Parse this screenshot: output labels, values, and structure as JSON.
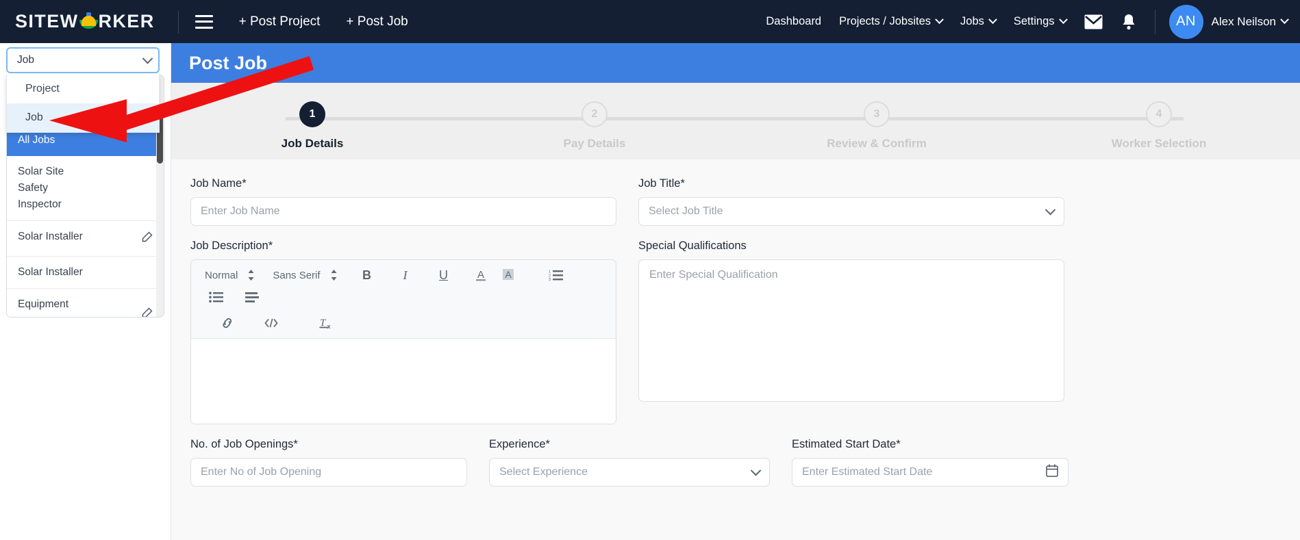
{
  "brand": {
    "name_part1": "SITEW",
    "name_part2": "RKER",
    "helmet_icon": "hardhat-icon"
  },
  "topnav": {
    "menu_icon": "hamburger-icon",
    "post_project": "+ Post Project",
    "post_job": "+ Post Job",
    "links": [
      {
        "label": "Dashboard",
        "caret": false
      },
      {
        "label": "Projects / Jobsites",
        "caret": true
      },
      {
        "label": "Jobs",
        "caret": true
      },
      {
        "label": "Settings",
        "caret": true
      }
    ],
    "mail_icon": "envelope-icon",
    "bell_icon": "bell-icon",
    "avatar_initials": "AN",
    "username": "Alex Neilson"
  },
  "left_panel": {
    "type_select": {
      "value": "Job",
      "chevron": "chevron-down-icon"
    },
    "dropdown_options": [
      {
        "label": "Project",
        "selected": false
      },
      {
        "label": "Job",
        "selected": true
      }
    ],
    "job_list": [
      {
        "label": "All Jobs",
        "active": true,
        "editable": false
      },
      {
        "label": "Solar Site Safety Inspector",
        "active": false,
        "editable": false
      },
      {
        "label": "Solar Installer",
        "active": false,
        "editable": true
      },
      {
        "label": "Solar Installer",
        "active": false,
        "editable": false
      },
      {
        "label": "Equipment",
        "active": false,
        "editable": true
      }
    ],
    "edit_icon": "pencil-icon",
    "scrollbar": "vertical-scrollbar"
  },
  "page": {
    "title": "Post Job",
    "accent_blue": "#3d7fe0",
    "dark_navy": "#141f33"
  },
  "stepper": [
    {
      "num": "1",
      "caption": "Job Details",
      "state": "done"
    },
    {
      "num": "2",
      "caption": "Pay Details",
      "state": "todo"
    },
    {
      "num": "3",
      "caption": "Review & Confirm",
      "state": "todo"
    },
    {
      "num": "4",
      "caption": "Worker Selection",
      "state": "todo"
    }
  ],
  "form": {
    "job_name": {
      "label": "Job Name*",
      "placeholder": "Enter Job Name",
      "value": ""
    },
    "job_title": {
      "label": "Job Title*",
      "placeholder": "Select Job Title",
      "value": "",
      "chevron": "chevron-down-icon"
    },
    "job_description": {
      "label": "Job Description*",
      "value": ""
    },
    "special_qualifications": {
      "label": "Special Qualifications",
      "placeholder": "Enter Special Qualification",
      "value": ""
    },
    "openings": {
      "label": "No. of Job Openings*",
      "placeholder": "Enter No of Job Opening",
      "value": ""
    },
    "experience": {
      "label": "Experience*",
      "placeholder": "Select Experience",
      "value": "",
      "chevron": "chevron-down-icon"
    },
    "start_date": {
      "label": "Estimated Start Date*",
      "placeholder": "Enter Estimated Start Date",
      "value": "",
      "icon": "calendar-icon"
    }
  },
  "editor_toolbar": {
    "heading": "Normal",
    "font": "Sans Serif",
    "bold": "B",
    "italic": "I",
    "underline": "U",
    "color": "A",
    "background": "A",
    "link_icon": "link-icon",
    "code_icon": "code-icon",
    "clear_format_icon": "clear-formatting-icon",
    "ordered_list_icon": "ordered-list-icon",
    "bullet_list_icon": "bullet-list-icon",
    "indent_icon": "indent-icon"
  },
  "annotation": {
    "arrow": "red-arrow-pointer"
  }
}
